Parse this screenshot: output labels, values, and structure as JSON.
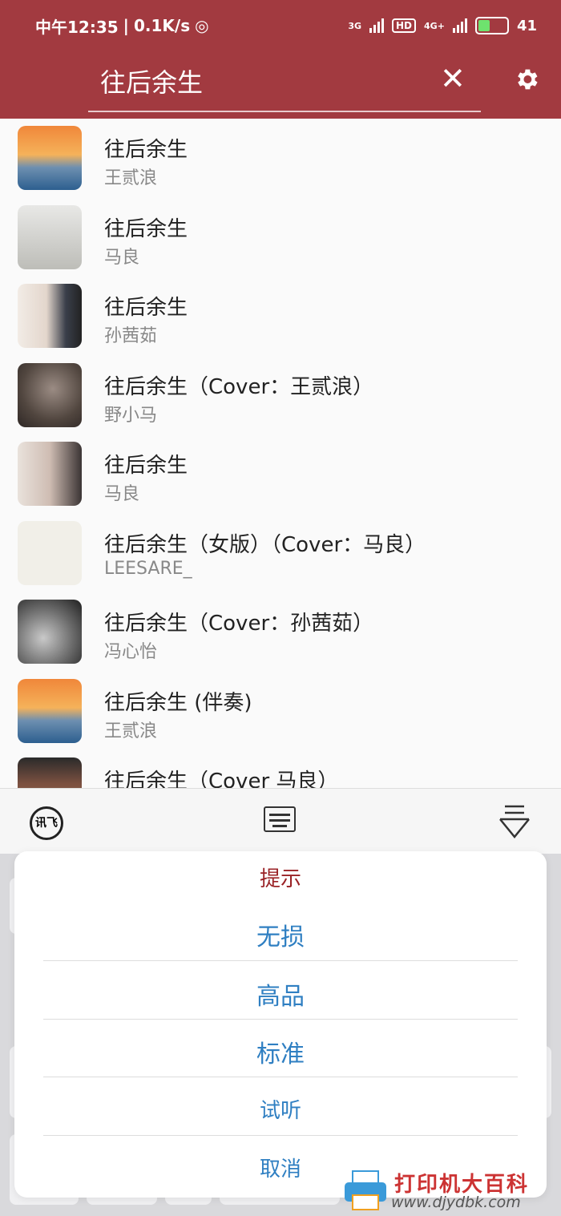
{
  "status_bar": {
    "time": "中午12:35",
    "net_speed": "0.1K/s",
    "net_3g": "3G",
    "hd": "HD",
    "net_4g": "4G+",
    "battery": "41"
  },
  "search": {
    "query": "往后余生"
  },
  "songs": [
    {
      "title": "往后余生",
      "artist": "王贰浪"
    },
    {
      "title": "往后余生",
      "artist": "马良"
    },
    {
      "title": "往后余生",
      "artist": "孙茜茹"
    },
    {
      "title": "往后余生（Cover：王贰浪）",
      "artist": "野小马"
    },
    {
      "title": "往后余生",
      "artist": "马良"
    },
    {
      "title": "往后余生（女版）（Cover：马良）",
      "artist": "LEESARE_"
    },
    {
      "title": "往后余生（Cover：孙茜茹）",
      "artist": "冯心怡"
    },
    {
      "title": "往后余生 (伴奏)",
      "artist": "王贰浪"
    },
    {
      "title": "往后余生（Cover 马良）",
      "artist": ""
    }
  ],
  "keyboard": {
    "logo": "讯飞"
  },
  "dialog": {
    "title": "提示",
    "options": [
      "无损",
      "高品",
      "标准",
      "试听",
      "取消"
    ]
  },
  "watermark": {
    "cn": "打印机大百科",
    "url": "www.djydbk.com"
  },
  "colors": {
    "header": "#a23a40",
    "accent": "#2f7fc2",
    "title_red": "#9a2226"
  }
}
